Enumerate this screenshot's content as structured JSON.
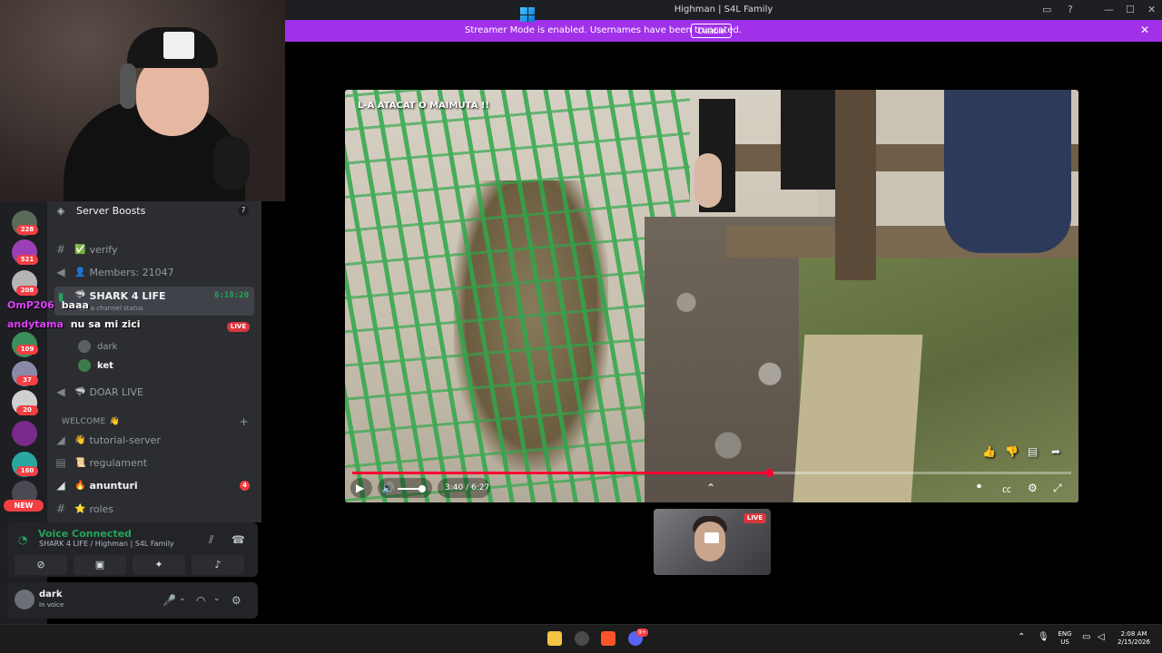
{
  "window": {
    "title": "Highman | S4L Family",
    "minimize": "—",
    "maximize": "☐",
    "close": "✕"
  },
  "banner": {
    "text": "Streamer Mode is enabled. Usernames have been truncated.",
    "button": "Disable",
    "close": "✕"
  },
  "sidebar": {
    "boosts": {
      "label": "Server Boosts",
      "count": "7"
    },
    "channels": [
      {
        "label": "verify",
        "emoji": "✅"
      },
      {
        "label": "Members: 21047",
        "emoji": "👤"
      }
    ],
    "active_voice": {
      "label": "SHARK 4 LIFE",
      "timer": "6:18:20",
      "sub": "Set a channel status"
    },
    "live_badge": "LIVE",
    "voice_users": [
      "dark",
      "ket"
    ],
    "doar_live": "DOAR LIVE",
    "category": {
      "label": "WELCOME",
      "emoji": "👋",
      "plus": "+"
    },
    "text_channels": [
      {
        "label": "tutorial-server",
        "emoji": "👋"
      },
      {
        "label": "regulament",
        "emoji": "📜"
      },
      {
        "label": "anunturi",
        "emoji": "🔥",
        "badge": "4"
      },
      {
        "label": "roles",
        "emoji": "⭐"
      }
    ]
  },
  "servers": {
    "badges": [
      "228",
      "521",
      "208",
      "109",
      "37",
      "20",
      "160"
    ],
    "new_pill": "NEW"
  },
  "chat_overlay": [
    {
      "name": "OmP206",
      "text": "baaa"
    },
    {
      "name": "andytama",
      "text": "nu sa mi zici"
    }
  ],
  "voice": {
    "status": "Voice Connected",
    "sub": "SHARK 4 LIFE / Highman | S4L Family"
  },
  "user": {
    "name": "dark",
    "status": "In voice"
  },
  "video": {
    "caption": "L-A ATACAT O MAIMUTA !!",
    "time": "3:40 / 6:27",
    "progress": 0.58
  },
  "cam": {
    "live": "LIVE"
  },
  "taskbar": {
    "lang": "ENG",
    "region": "US",
    "time": "2:08 AM",
    "date": "2/15/2026",
    "discord_badge": "9+"
  },
  "colors": {
    "banner": "#a031e8",
    "live": "#da373c",
    "voice_green": "#23a55a",
    "progress": "#ff0033"
  }
}
